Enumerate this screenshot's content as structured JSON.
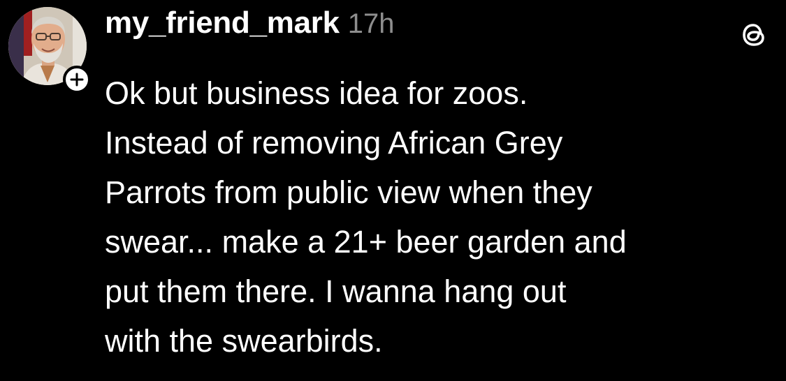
{
  "post": {
    "author": "my_friend_mark",
    "timestamp": "17h",
    "lines": [
      "Ok but business idea for zoos.",
      "Instead of removing African Grey",
      "Parrots from public view when they",
      "swear... make a 21+ beer garden and",
      "put them there. I wanna hang out",
      "with the swearbirds."
    ]
  },
  "icons": {
    "follow": "plus-icon",
    "app": "threads-logo-icon",
    "avatar": "user-avatar"
  },
  "colors": {
    "background": "#000000",
    "text": "#ffffff",
    "muted": "#8e8e8e"
  }
}
